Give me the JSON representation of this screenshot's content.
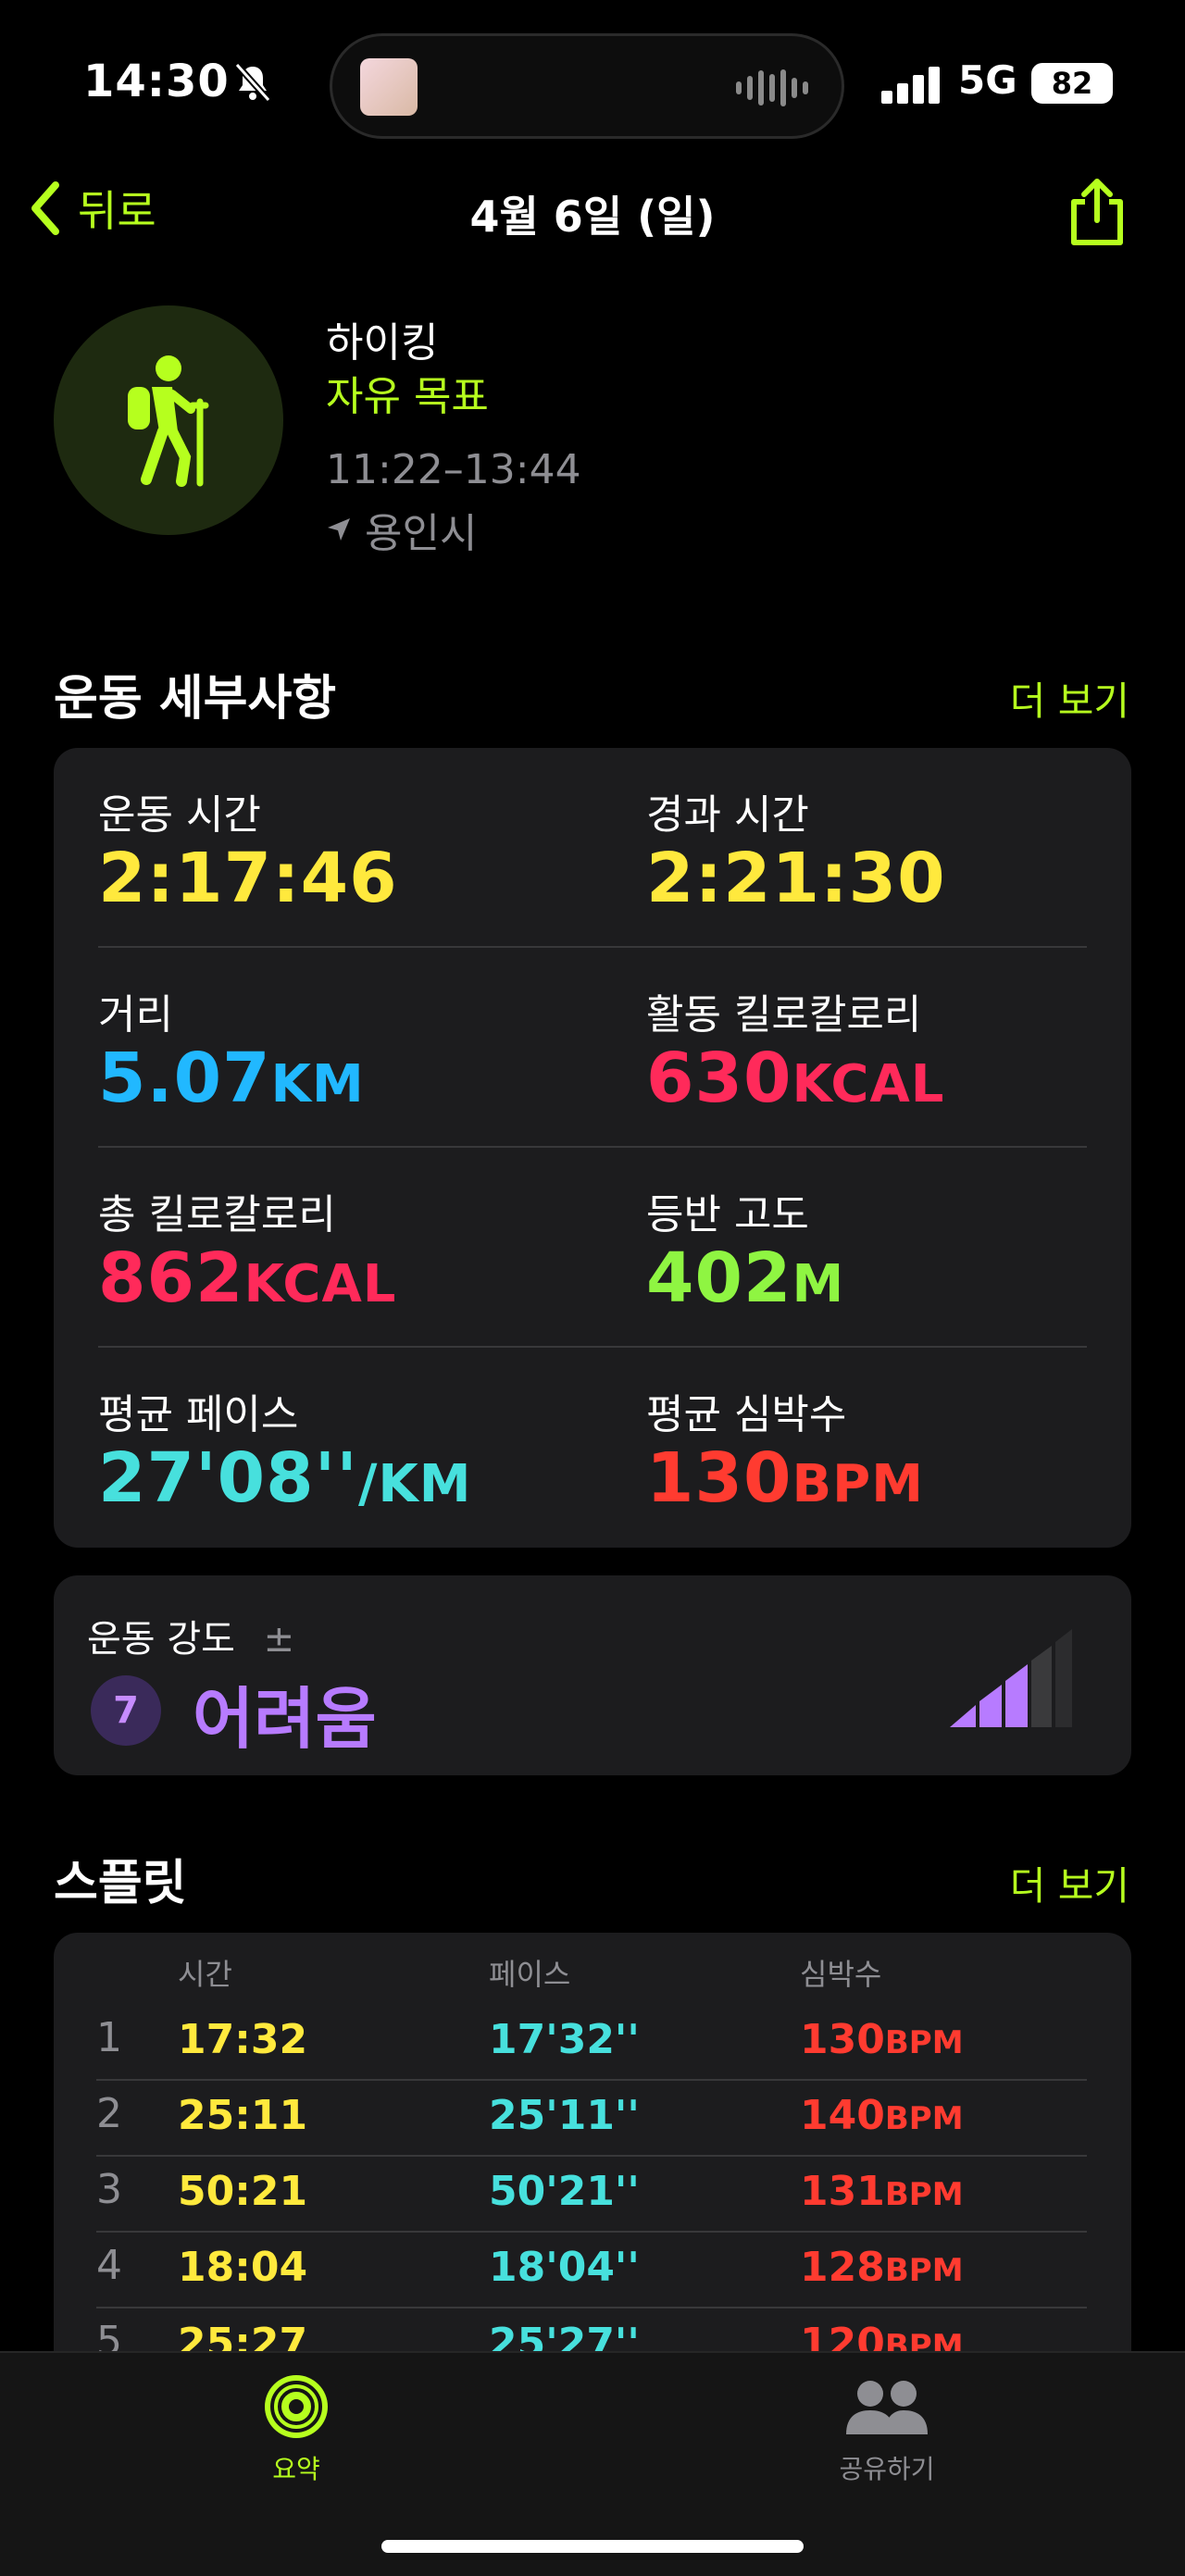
{
  "status": {
    "time": "14:30",
    "network": "5G",
    "battery": "82"
  },
  "nav": {
    "back_label": "뒤로",
    "title": "4월 6일 (일)"
  },
  "workout": {
    "type": "하이킹",
    "goal": "자유 목표",
    "time_range": "11:22–13:44",
    "location": "용인시"
  },
  "details": {
    "title": "운동 세부사항",
    "more": "더 보기",
    "metrics": [
      {
        "label": "운동 시간",
        "value": "2:17:46",
        "unit": "",
        "color": "#ffe93d"
      },
      {
        "label": "경과 시간",
        "value": "2:21:30",
        "unit": "",
        "color": "#ffe93d"
      },
      {
        "label": "거리",
        "value": "5.07",
        "unit": "KM",
        "color": "#21b8ff"
      },
      {
        "label": "활동 킬로칼로리",
        "value": "630",
        "unit": "KCAL",
        "color": "#ff2a5a"
      },
      {
        "label": "총 킬로칼로리",
        "value": "862",
        "unit": "KCAL",
        "color": "#ff2a5a"
      },
      {
        "label": "등반 고도",
        "value": "402",
        "unit": "M",
        "color": "#8ff542"
      },
      {
        "label": "평균 페이스",
        "value": "27'08''",
        "unit": "/KM",
        "color": "#47e0dd"
      },
      {
        "label": "평균 심박수",
        "value": "130",
        "unit": "BPM",
        "color": "#ff3b30"
      }
    ]
  },
  "intensity": {
    "label": "운동 강도",
    "plusminus": "±",
    "level": "7",
    "text": "어려움"
  },
  "splits": {
    "title": "스플릿",
    "more": "더 보기",
    "headers": [
      "시간",
      "페이스",
      "심박수"
    ],
    "rows": [
      {
        "n": "1",
        "time": "17:32",
        "pace": "17'32''",
        "hr": "130",
        "unit": "BPM"
      },
      {
        "n": "2",
        "time": "25:11",
        "pace": "25'11''",
        "hr": "140",
        "unit": "BPM"
      },
      {
        "n": "3",
        "time": "50:21",
        "pace": "50'21''",
        "hr": "131",
        "unit": "BPM"
      },
      {
        "n": "4",
        "time": "18:04",
        "pace": "18'04''",
        "hr": "128",
        "unit": "BPM"
      },
      {
        "n": "5",
        "time": "25:27",
        "pace": "25'27''",
        "hr": "120",
        "unit": "BPM"
      }
    ]
  },
  "tabs": [
    {
      "label": "요약",
      "icon": "activity-rings-icon"
    },
    {
      "label": "공유하기",
      "icon": "sharing-people-icon"
    }
  ],
  "colors": {
    "accent": "#b6ff1e",
    "time": "#ffe93d",
    "pace": "#47e0dd",
    "heart": "#ff3b30"
  }
}
